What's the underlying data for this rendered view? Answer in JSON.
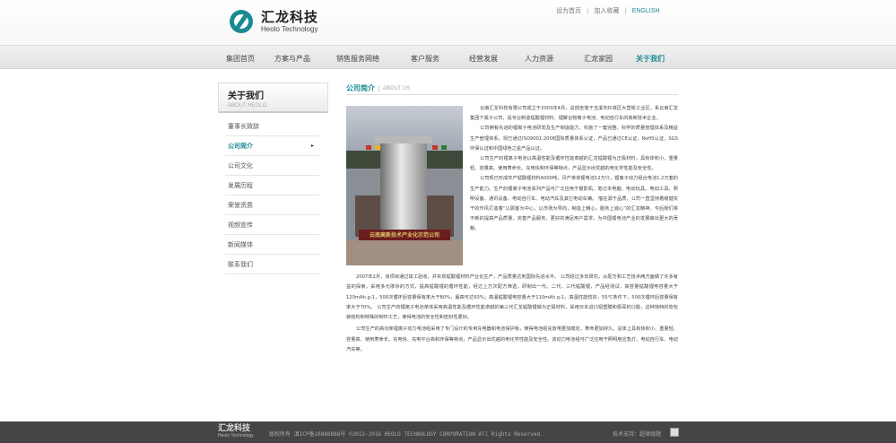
{
  "header": {
    "logo_cn": "汇龙科技",
    "logo_en": "Heolo Technology",
    "toplinks": [
      "设为首页",
      "加入收藏",
      "ENGLISH"
    ]
  },
  "nav": [
    "集团首页",
    "方案与产品",
    "销售服务网络",
    "客户服务",
    "经营发展",
    "人力资源",
    "汇龙家园",
    "关于我们"
  ],
  "nav_active": "关于我们",
  "sidebar": {
    "title": "关于我们",
    "subtitle": "ABOUT HEOLO",
    "items": [
      "董事长致辞",
      "公司简介",
      "公司文化",
      "发展历程",
      "荣誉资质",
      "视频宣传",
      "新闻媒体",
      "联系我们"
    ],
    "active": "公司简介",
    "arrow": "▸"
  },
  "content": {
    "crumb_cn": "公司简介",
    "crumb_sep": "|",
    "crumb_en": "ABOUT US",
    "photo_sign": "云南高新技术产业化示范公司",
    "side_paragraphs": [
      "云南汇龙科技有限公司成立于2003年4月，总部坐落于玉溪市红塔区大营街工业区，系云南汇龙集团下属子公司，是专业制造锰酸锂材料、锂聚合物离子电池、电动自行车的高新技术企业。",
      "公司拥有先进的锂离子电池研发及生产制造能力，实施了一套完整、科学的质量管理体系及精益生产管理体系，现已通过ISO9001:2008国际质量体系认证，产品已通过CE认证、RoHS认证、SGS环保认证和中国绿色之星产品认证。",
      "公司生产的锂离子电池以高温性能及循环性能卓越的汇龙锰酸锂为正极材料，具有体积小、重量轻、容量高、使用寿命长、充电快和环保等特点，产品显示出优越的电化学性能及安全性。",
      "公司现已形成年产锰酸锂材料6000吨，月产单体锂电池12万只，锂离子动力组合电池1.2万套的生产能力。生产的锂离子电池系列产品可广泛应用于摄影机、笔记本电脑、电动玩具、电动工具、照明设备、通讯设备、电动自行车、电动汽车及其它电动车辆。  借在源于品质，公司一直坚持着稳健实干的作风打造着“以顾客为中心，以市场为导向，制造上精心，服务上诚心”的汇龙精神。今后我们将不断的提高产品质量，完善产品服务，更好的满足用户需求，为中国锂电池产业的发展做出更大的贡献。"
    ],
    "full_paragraphs": [
      "2007年2月，该项目通过竣工验收，并实现锰酸锂材料产业化生产，产品质量达到国际先进水平。 公司经过多年研究，从配方和工艺技术两方面做了许多有益的探索，采用多元掺杂的方式，提高锰酸锂的循环性能，经过上万次配方筛选，研制出一代、二代、三代锰酸锂，产品经测试，高容量锰酸锂电容量大于120mAh.g-1，500次循环后容量保有率大于80%，最高可达93%；高温锰酸锂电容量大于110mAh.g-1，高温性能较好，55℃条件下，500次循环后容量保有率大于70%。  公司生产的锂离子电池单体采用高温性能及循环性能卓越的第三代汇龙锰酸锂做为正极材料，采用日本进口铝塑膜和极耳封口胶，这种独特的软包装结构和特殊的制作工艺，使得电池的安全性和密封性更好。",
      "公司生产的高功率锂离子动力电池组采用了专门设计的专用充电器和电池保护板，使得电池组充放电更加稳定，寿命更加持久。总体上具有体积小、重量轻、容量高、使用寿命长、充电快、充电平台高和环保等特点，产品显示出优越的电化学性能及安全性。该动力电池组可广泛应用于照明用应急灯、电动自行车、电动汽车等。"
    ]
  },
  "footer": {
    "logo_cn": "汇龙科技",
    "logo_en": "Heolo Technology",
    "copyright": "版权所有 滇ICP备10888888号 ©2012-2016 HEOLO TECHNOLOGY CORPORATION All Rights Reserved.",
    "support": "技术支持：超律组题"
  }
}
